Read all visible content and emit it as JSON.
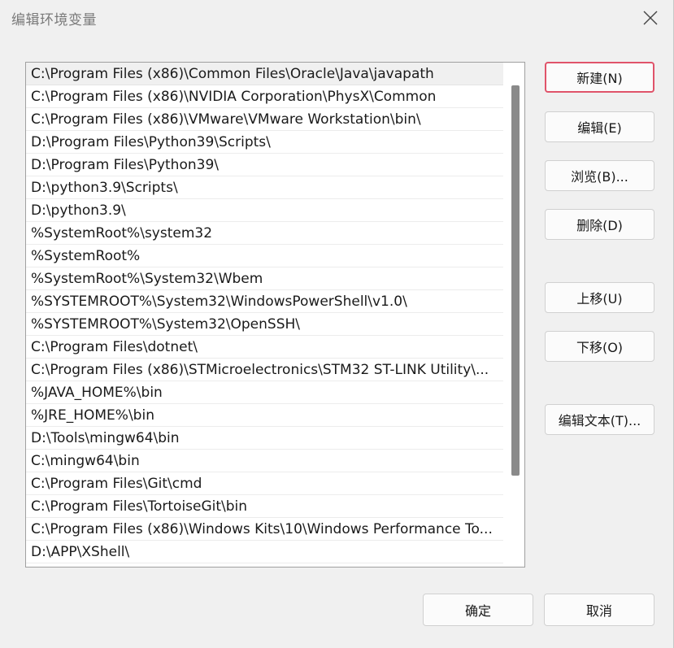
{
  "title": "编辑环境变量",
  "icons": {
    "close": "close-icon"
  },
  "paths": [
    "C:\\Program Files (x86)\\Common Files\\Oracle\\Java\\javapath",
    "C:\\Program Files (x86)\\NVIDIA Corporation\\PhysX\\Common",
    "C:\\Program Files (x86)\\VMware\\VMware Workstation\\bin\\",
    "D:\\Program Files\\Python39\\Scripts\\",
    "D:\\Program Files\\Python39\\",
    "D:\\python3.9\\Scripts\\",
    "D:\\python3.9\\",
    "%SystemRoot%\\system32",
    "%SystemRoot%",
    "%SystemRoot%\\System32\\Wbem",
    "%SYSTEMROOT%\\System32\\WindowsPowerShell\\v1.0\\",
    "%SYSTEMROOT%\\System32\\OpenSSH\\",
    "C:\\Program Files\\dotnet\\",
    "C:\\Program Files (x86)\\STMicroelectronics\\STM32 ST-LINK Utility\\...",
    "%JAVA_HOME%\\bin",
    "%JRE_HOME%\\bin",
    "D:\\Tools\\mingw64\\bin",
    "C:\\mingw64\\bin",
    "C:\\Program Files\\Git\\cmd",
    "C:\\Program Files\\TortoiseGit\\bin",
    "C:\\Program Files (x86)\\Windows Kits\\10\\Windows Performance To...",
    "D:\\APP\\XShell\\"
  ],
  "selected_index": 0,
  "buttons": {
    "new": "新建(N)",
    "edit": "编辑(E)",
    "browse": "浏览(B)...",
    "delete": "删除(D)",
    "move_up": "上移(U)",
    "move_down": "下移(O)",
    "edit_text": "编辑文本(T)...",
    "ok": "确定",
    "cancel": "取消"
  },
  "colors": {
    "default_button_border": "#e0536a",
    "background": "#f0f0f0"
  }
}
